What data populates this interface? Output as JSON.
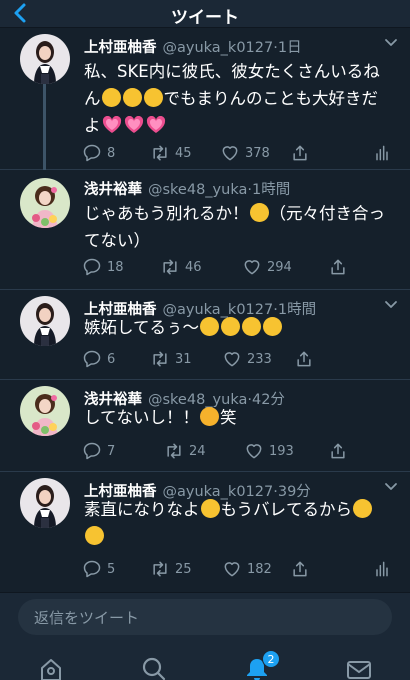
{
  "header": {
    "title": "ツイート"
  },
  "tweets": [
    {
      "name": "上村亜柚香",
      "handle": "@ayuka_k0127",
      "time": "·1日",
      "text_a": "私、SKE内に彼氏、彼女たくさんいるね",
      "text_b": "ん",
      "text_c": "でもまりんのことも大好きだ",
      "text_d": "よ",
      "reply_count": "8",
      "retweet_count": "45",
      "like_count": "378"
    },
    {
      "name": "浅井裕華",
      "handle": "@ske48_yuka",
      "time": "·1時間",
      "text_a": "じゃあもう別れるか！",
      "text_b": "（元々付き合っ",
      "text_c": "てない）",
      "reply_count": "18",
      "retweet_count": "46",
      "like_count": "294"
    },
    {
      "name": "上村亜柚香",
      "handle": "@ayuka_k0127",
      "time": "·1時間",
      "text_a": "嫉妬してるぅ〜",
      "reply_count": "6",
      "retweet_count": "31",
      "like_count": "233"
    },
    {
      "name": "浅井裕華",
      "handle": "@ske48_yuka",
      "time": "·42分",
      "text_a": "してないし！！",
      "text_b": "笑",
      "reply_count": "7",
      "retweet_count": "24",
      "like_count": "193"
    },
    {
      "name": "上村亜柚香",
      "handle": "@ayuka_k0127",
      "time": "·39分",
      "text_a": "素直になりなよ",
      "text_b": "もうバレてるから",
      "reply_count": "5",
      "retweet_count": "25",
      "like_count": "182"
    }
  ],
  "reply_bar": {
    "placeholder": "返信をツイート"
  },
  "tabbar": {
    "notification_badge": "2"
  },
  "icons": [
    "back-chevron-icon",
    "caret-down-icon",
    "reply-icon",
    "retweet-icon",
    "like-icon",
    "share-icon",
    "analytics-icon",
    "home-icon",
    "search-icon",
    "notifications-bell-icon",
    "messages-icon"
  ],
  "colors": {
    "accent": "#1da1f2",
    "background": "#15202b",
    "muted": "#8899a6",
    "heart": "#e0245e"
  }
}
